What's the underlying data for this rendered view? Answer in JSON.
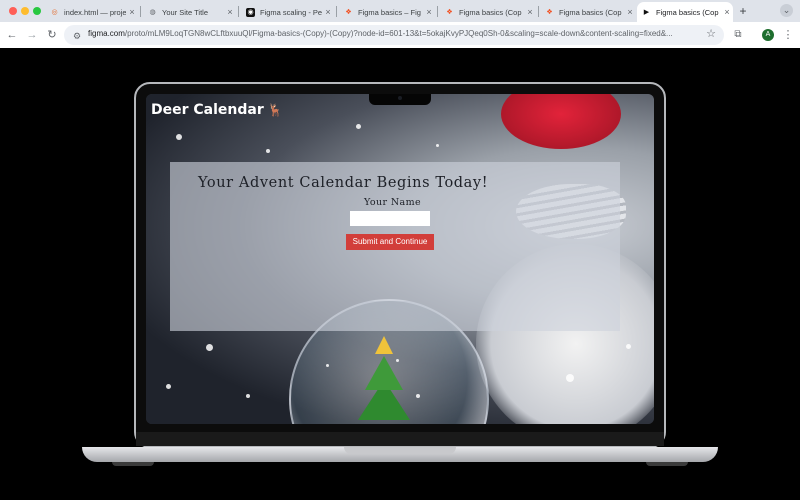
{
  "browser": {
    "tabs": [
      {
        "title": "index.html — proje",
        "favicon": "wheel-icon"
      },
      {
        "title": "Your Site Title",
        "favicon": "globe-icon"
      },
      {
        "title": "Figma scaling - Pe",
        "favicon": "app-icon"
      },
      {
        "title": "Figma basics – Fig",
        "favicon": "figma-icon"
      },
      {
        "title": "Figma basics (Cop",
        "favicon": "figma-icon"
      },
      {
        "title": "Figma basics (Cop",
        "favicon": "figma-icon"
      },
      {
        "title": "Figma basics (Cop",
        "favicon": "play-icon",
        "active": true
      }
    ],
    "new_tab": "+",
    "tab_menu": "⌄",
    "nav": {
      "back": "←",
      "forward": "→",
      "reload": "↻"
    },
    "url_host": "figma.com",
    "url_path": "/proto/mLM9LoqTGN8wCLftbxuuQl/Figma-basics-(Copy)-(Copy)?node-id=601-13&t=5okajKvyPJQeq0Sh-0&scaling=scale-down&content-scaling=fixed&...",
    "star": "☆",
    "extensions": "⧉",
    "profile_initial": "A",
    "menu": "⋮"
  },
  "site": {
    "brand": "Deer Calendar",
    "brand_icon": "deer-icon",
    "heading": "Your Advent Calendar Begins Today!",
    "name_label": "Your Name",
    "name_value": "",
    "submit_label": "Submit and Continue"
  },
  "colors": {
    "accent_button": "#d23e3a",
    "chrome_bg": "#dfe3ea"
  }
}
